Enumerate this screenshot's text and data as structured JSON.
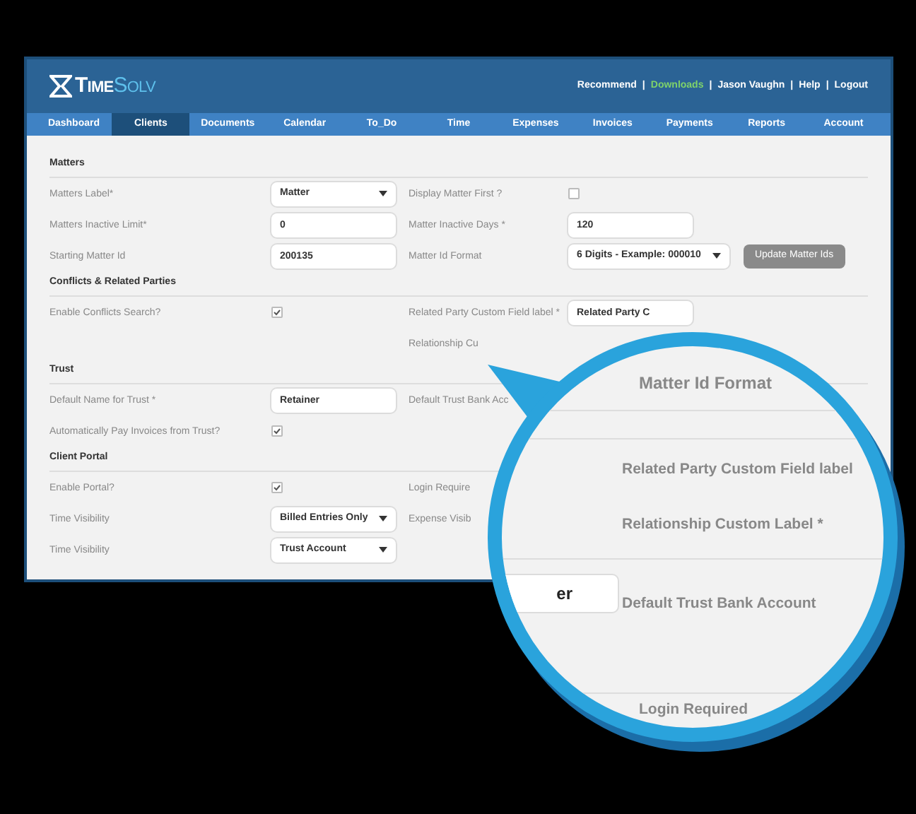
{
  "logo": {
    "part1": "Time",
    "part2": "Solv"
  },
  "header_links": [
    {
      "label": "Recommend",
      "kind": "plain"
    },
    {
      "label": "Downloads",
      "kind": "highlight"
    },
    {
      "label": "Jason Vaughn",
      "kind": "plain"
    },
    {
      "label": "Help",
      "kind": "plain"
    },
    {
      "label": "Logout",
      "kind": "plain"
    }
  ],
  "separator": "|",
  "tabs": [
    {
      "label": "Dashboard",
      "selected": false
    },
    {
      "label": "Clients",
      "selected": true
    },
    {
      "label": "Documents",
      "selected": false
    },
    {
      "label": "Calendar",
      "selected": false
    },
    {
      "label": "To_Do",
      "selected": false
    },
    {
      "label": "Time",
      "selected": false
    },
    {
      "label": "Expenses",
      "selected": false
    },
    {
      "label": "Invoices",
      "selected": false
    },
    {
      "label": "Payments",
      "selected": false
    },
    {
      "label": "Reports",
      "selected": false
    },
    {
      "label": "Account",
      "selected": false
    }
  ],
  "sections": [
    {
      "heading": "Matters",
      "rows": [
        {
          "left": {
            "label": "Matters Label*",
            "control": {
              "kind": "select",
              "value": "Matter"
            }
          },
          "right": {
            "label": "Display Matter First ?",
            "control": {
              "kind": "checkbox",
              "checked": false
            }
          }
        },
        {
          "left": {
            "label": "Matters Inactive Limit*",
            "control": {
              "kind": "input",
              "value": "0"
            }
          },
          "right": {
            "label": "Matter Inactive Days *",
            "control": {
              "kind": "input",
              "value": "120"
            }
          }
        },
        {
          "left": {
            "label": "Starting Matter Id",
            "control": {
              "kind": "input",
              "value": "200135"
            }
          },
          "right": {
            "label": "Matter Id Format",
            "control": {
              "kind": "select",
              "value": "6 Digits - Example: 000010"
            },
            "button": "Update Matter Ids"
          }
        }
      ]
    },
    {
      "heading": "Conflicts & Related Parties",
      "rows": [
        {
          "left": {
            "label": "Enable Conflicts Search?",
            "control": {
              "kind": "checkbox",
              "checked": true
            }
          },
          "right": {
            "label": "Related Party Custom Field label *",
            "control": {
              "kind": "input",
              "value": "Related Party C"
            }
          }
        },
        {
          "right": {
            "label": "Relationship Cu"
          }
        }
      ]
    },
    {
      "heading": "Trust",
      "rows": [
        {
          "left": {
            "label": "Default Name for Trust *",
            "control": {
              "kind": "input",
              "value": "Retainer"
            }
          },
          "right": {
            "label": "Default Trust Bank Acc"
          }
        },
        {
          "left": {
            "label": "Automatically Pay Invoices from Trust?",
            "control": {
              "kind": "checkbox",
              "checked": true
            }
          }
        }
      ]
    },
    {
      "heading": "Client Portal",
      "rows": [
        {
          "left": {
            "label": "Enable Portal?",
            "control": {
              "kind": "checkbox",
              "checked": true
            }
          },
          "right": {
            "label": "Login Require"
          }
        },
        {
          "left": {
            "label": "Time Visibility",
            "control": {
              "kind": "select",
              "value": "Billed Entries Only"
            }
          },
          "right": {
            "label": "Expense Visib"
          }
        },
        {
          "left": {
            "label": "Time Visibility",
            "control": {
              "kind": "select",
              "value": "Trust Account"
            }
          }
        }
      ]
    }
  ],
  "magnifier": {
    "title": "Matter Id Format",
    "label_1": "Related Party Custom Field label",
    "label_2": "Relationship Custom Label *",
    "field_value": "er",
    "label_3": "Default Trust Bank Account",
    "label_4": "Login Required"
  }
}
